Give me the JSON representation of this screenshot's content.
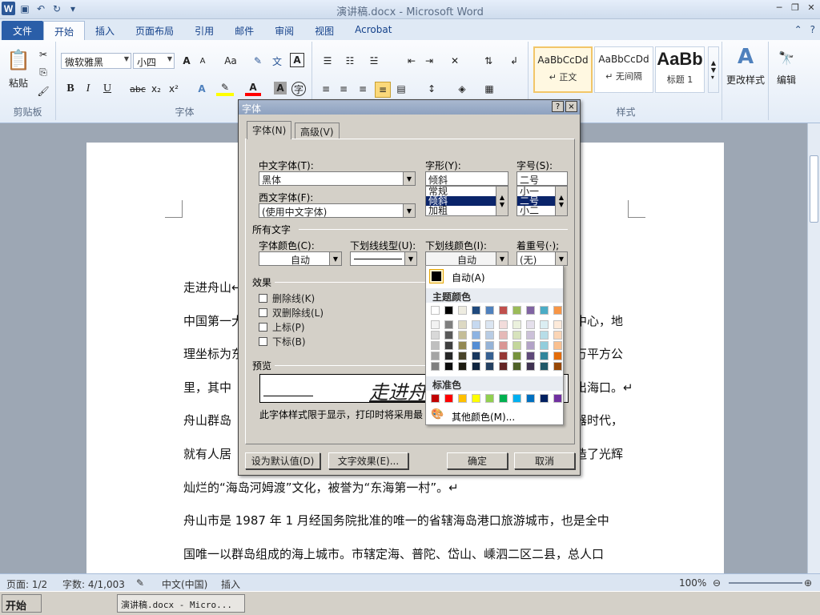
{
  "window": {
    "title": "演讲稿.docx - Microsoft Word"
  },
  "ribbon": {
    "tabs": [
      "文件",
      "开始",
      "插入",
      "页面布局",
      "引用",
      "邮件",
      "审阅",
      "视图",
      "Acrobat"
    ],
    "clipboard": {
      "paste_label": "粘贴",
      "group_label": "剪贴板"
    },
    "font": {
      "font_name": "微软雅黑",
      "font_size": "小四",
      "group_label": "字体",
      "grow_label": "A",
      "shrink_label": "A",
      "case_label": "Aa",
      "bold": "B",
      "italic": "I",
      "underline": "U",
      "strike": "abc",
      "subscript": "x₂",
      "superscript": "x²"
    },
    "styles": {
      "items": [
        {
          "sample": "AaBbCcDd",
          "name": "↵ 正文"
        },
        {
          "sample": "AaBbCcDd",
          "name": "↵ 无间隔"
        },
        {
          "sample": "AaBb",
          "name": "标题 1"
        }
      ],
      "change_styles_label": "更改样式",
      "group_label": "样式"
    },
    "editing": {
      "label": "编辑"
    }
  },
  "document": {
    "lines": [
      "走进舟山↵",
      "中国第一大",
      "理坐标为东",
      "里，其中",
      "舟山群岛",
      "就有人居",
      "灿烂的“海岛河姆渡”文化，被誉为“东海第一村”。↵",
      "舟山市是 1987 年 1 月经国务院批准的唯一的省辖海岛港口旅游城市，也是全中",
      "国唯一以群岛组成的海上城市。市辖定海、普陀、岱山、嵊泗二区二县，总人口"
    ],
    "right_fragments": [
      "中心，地",
      "万平方公",
      "出海口。↵",
      "器时代，",
      "造了光辉"
    ]
  },
  "dialog": {
    "title": "字体",
    "help_btn": "?",
    "close_btn": "×",
    "tabs": [
      "字体(N)",
      "高级(V)"
    ],
    "chinese_font_label": "中文字体(T):",
    "chinese_font_value": "黑体",
    "western_font_label": "西文字体(F):",
    "western_font_value": "(使用中文字体)",
    "style_label": "字形(Y):",
    "style_value": "倾斜",
    "style_list": [
      "常规",
      "倾斜",
      "加粗"
    ],
    "size_label": "字号(S):",
    "size_value": "二号",
    "size_list": [
      "小一",
      "二号",
      "小二"
    ],
    "all_text_label": "所有文字",
    "font_color_label": "字体颜色(C):",
    "font_color_value": "自动",
    "underline_type_label": "下划线线型(U):",
    "underline_color_label": "下划线颜色(I):",
    "underline_color_value": "自动",
    "emphasis_label": "着重号(·);",
    "emphasis_value": "(无)",
    "effects_label": "效果",
    "effects": [
      "删除线(K)",
      "双删除线(L)",
      "上标(P)",
      "下标(B)"
    ],
    "preview_label": "预览",
    "preview_text": "走进舟",
    "preview_note": "此字体样式限于显示，打印时将采用最",
    "set_default_btn": "设为默认值(D)",
    "text_effects_btn": "文字效果(E)...",
    "ok_btn": "确定",
    "cancel_btn": "取消"
  },
  "palette": {
    "auto_label": "自动(A)",
    "theme_label": "主题颜色",
    "standard_label": "标准色",
    "more_label": "其他颜色(M)...",
    "theme_top": [
      "#ffffff",
      "#000000",
      "#eeece1",
      "#1f497d",
      "#4f81bd",
      "#c0504d",
      "#9bbb59",
      "#8064a2",
      "#4bacc6",
      "#f79646"
    ],
    "theme_shades": [
      [
        "#f2f2f2",
        "#7f7f7f",
        "#ddd9c3",
        "#c6d9f0",
        "#dbe5f1",
        "#f2dcdb",
        "#ebf1dd",
        "#e5e0ec",
        "#dbeef3",
        "#fdeada"
      ],
      [
        "#d8d8d8",
        "#595959",
        "#c4bd97",
        "#8db3e2",
        "#b8cce4",
        "#e5b9b7",
        "#d7e3bc",
        "#ccc1d9",
        "#b7dde8",
        "#fbd5b5"
      ],
      [
        "#bfbfbf",
        "#3f3f3f",
        "#938953",
        "#548dd4",
        "#95b3d7",
        "#d99694",
        "#c3d69b",
        "#b2a2c7",
        "#92cddc",
        "#fac08f"
      ],
      [
        "#a5a5a5",
        "#262626",
        "#494429",
        "#17365d",
        "#366092",
        "#953734",
        "#76923c",
        "#5f497a",
        "#31859b",
        "#e36c09"
      ],
      [
        "#7f7f7f",
        "#0c0c0c",
        "#1d1b10",
        "#0f243e",
        "#244061",
        "#632423",
        "#4f6128",
        "#3f3151",
        "#205867",
        "#974806"
      ]
    ],
    "standard": [
      "#c00000",
      "#ff0000",
      "#ffc000",
      "#ffff00",
      "#92d050",
      "#00b050",
      "#00b0f0",
      "#0070c0",
      "#002060",
      "#7030a0"
    ]
  },
  "status": {
    "page": "页面: 1/2",
    "words": "字数: 4/1,003",
    "language": "中文(中国)",
    "mode": "插入",
    "zoom": "100%"
  },
  "taskbar": {
    "start": "开始",
    "task": "演讲稿.docx - Micro..."
  }
}
